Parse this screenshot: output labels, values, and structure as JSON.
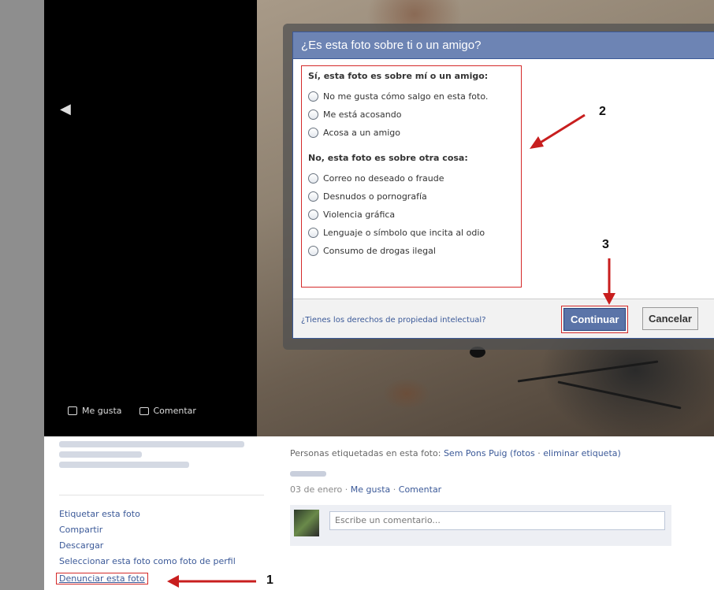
{
  "viewer": {
    "like_label": "Me gusta",
    "comment_label": "Comentar"
  },
  "dialog": {
    "title": "¿Es esta foto sobre ti o un amigo?",
    "group1_title": "Sí, esta foto es sobre mí o un amigo:",
    "group1_options": [
      "No me gusta cómo salgo en esta foto.",
      "Me está acosando",
      "Acosa a un amigo"
    ],
    "group2_title": "No, esta foto es sobre otra cosa:",
    "group2_options": [
      "Correo no deseado o fraude",
      "Desnudos o pornografía",
      "Violencia gráfica",
      "Lenguaje o símbolo que incita al odio",
      "Consumo de drogas ilegal"
    ],
    "ip_link": "¿Tienes los derechos de propiedad intelectual?",
    "continue_label": "Continuar",
    "cancel_label": "Cancelar"
  },
  "annotations": [
    "1",
    "2",
    "3"
  ],
  "actions": [
    "Etiquetar esta foto",
    "Compartir",
    "Descargar",
    "Seleccionar esta foto como foto de perfil"
  ],
  "report_label": "Denunciar esta foto",
  "tagged": {
    "prefix": "Personas etiquetadas en esta foto:",
    "person": "Sem Pons Puig",
    "fotos": "(fotos",
    "sep": "·",
    "remove": "eliminar etiqueta)"
  },
  "meta": {
    "date": "03 de enero",
    "sep": "·",
    "like": "Me gusta",
    "comment": "Comentar"
  },
  "comment_placeholder": "Escribe un comentario...",
  "colors": {
    "accent": "#3b5998",
    "annotation_red": "#d42a2a"
  }
}
